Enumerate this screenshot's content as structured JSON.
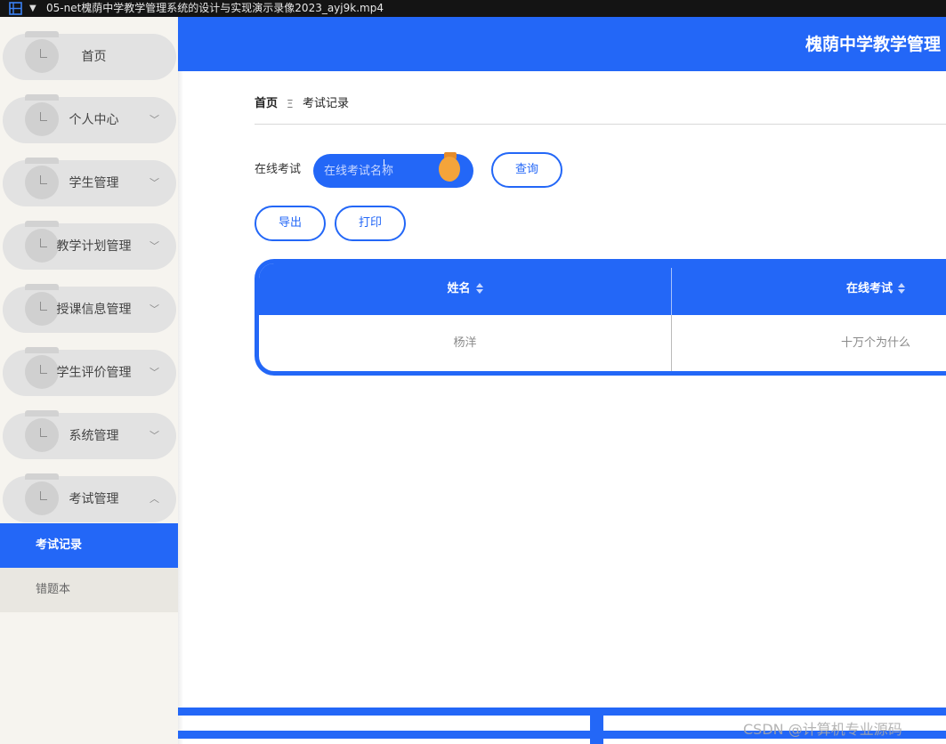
{
  "window": {
    "title": "05-net槐荫中学教学管理系统的设计与实现演示录像2023_ayj9k.mp4"
  },
  "header": {
    "site_title": "槐荫中学教学管理"
  },
  "sidebar": {
    "items": [
      {
        "label": "首页",
        "expandable": false
      },
      {
        "label": "个人中心",
        "expandable": true
      },
      {
        "label": "学生管理",
        "expandable": true
      },
      {
        "label": "教学计划管理",
        "expandable": true
      },
      {
        "label": "授课信息管理",
        "expandable": true
      },
      {
        "label": "学生评价管理",
        "expandable": true
      },
      {
        "label": "系统管理",
        "expandable": true
      },
      {
        "label": "考试管理",
        "expandable": true,
        "expanded": true
      }
    ],
    "chevron_down": "﹀",
    "chevron_up": "︿",
    "sub_items": [
      {
        "label": "考试记录",
        "active": true
      },
      {
        "label": "错题本",
        "active": false
      }
    ]
  },
  "breadcrumb": {
    "home": "首页",
    "separator": "Ξ",
    "current": "考试记录"
  },
  "search": {
    "label": "在线考试",
    "placeholder": "在线考试名称",
    "value": ""
  },
  "buttons": {
    "query": "查询",
    "export": "导出",
    "print": "打印"
  },
  "table": {
    "columns": [
      "姓名",
      "在线考试"
    ],
    "rows": [
      [
        "杨洋",
        "十万个为什么"
      ]
    ]
  },
  "watermark": "CSDN @计算机专业源码",
  "colors": {
    "primary": "#2367f7",
    "accent": "#f4a43a",
    "sidebar_bg": "#f6f4ef"
  }
}
